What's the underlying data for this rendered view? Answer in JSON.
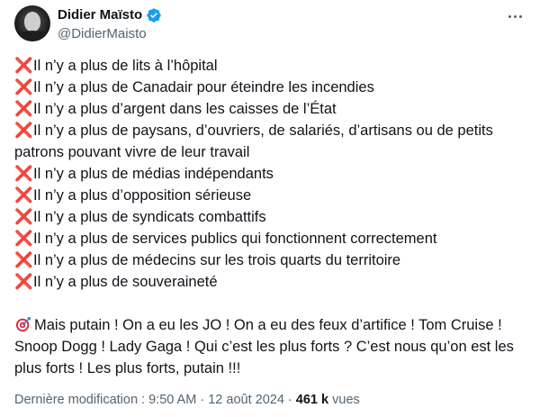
{
  "author": {
    "display_name": "Didier Maïsto",
    "handle": "@DidierMaisto",
    "verified": true,
    "avatar_icon": "profile-photo"
  },
  "colors": {
    "verified_badge": "#1d9bf0",
    "cross_mark": "#e0245e",
    "secondary_text": "#536471"
  },
  "tweet": {
    "lines": [
      "Il n’y a plus de lits à l’hôpital",
      "Il n’y a plus de Canadair pour éteindre les incendies",
      "Il n’y a plus d’argent dans les caisses de l’État",
      "Il n’y a plus de paysans, d’ouvriers, de salariés, d’artisans ou de petits patrons pouvant vivre de leur travail",
      "Il n’y a plus de médias indépendants",
      "Il n’y a plus d’opposition sérieuse",
      "Il n’y a plus de syndicats combattifs",
      "Il n’y a plus de services publics qui fonctionnent correctement",
      "Il n’y a plus de médecins sur les trois quarts du territoire",
      "Il n’y a plus de souveraineté"
    ],
    "closing": "Mais putain ! On a eu les JO ! On a eu des feux d’artifice ! Tom Cruise ! Snoop Dogg ! Lady Gaga ! Qui c’est les plus forts ? C’est nous qu’on est les plus forts ! Les plus forts, putain !!!"
  },
  "meta": {
    "edited_label": "Dernière modification",
    "time": "9:50 AM",
    "separator": "·",
    "date": "12 août 2024",
    "views_count": "461 k",
    "views_label": "vues"
  }
}
